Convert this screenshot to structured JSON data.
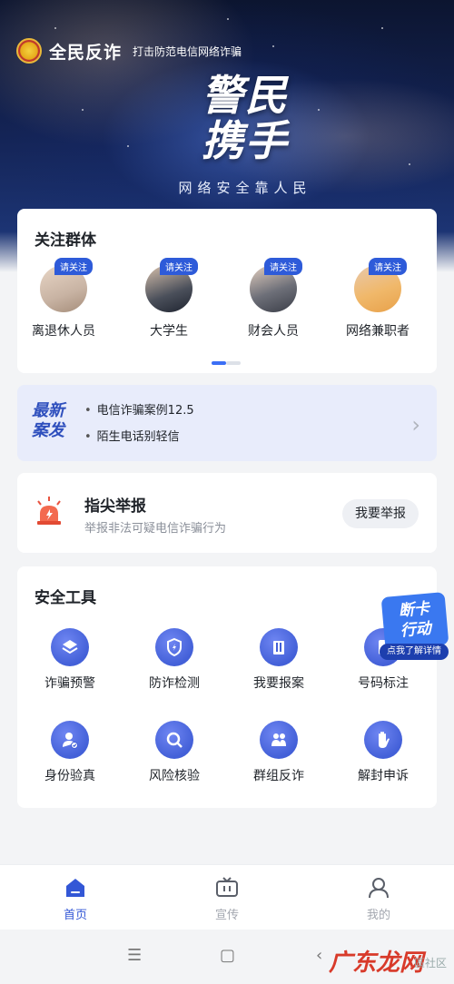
{
  "header": {
    "app_name": "全民反诈",
    "slogan": "打击防范电信网络诈骗"
  },
  "banner": {
    "title_line1": "警民",
    "title_line2": "携手",
    "subtitle": "网络安全靠人民"
  },
  "groups": {
    "title": "关注群体",
    "badge": "请关注",
    "items": [
      {
        "label": "离退休人员"
      },
      {
        "label": "大学生"
      },
      {
        "label": "财会人员"
      },
      {
        "label": "网络兼职者"
      }
    ]
  },
  "news": {
    "logo_line1": "最新",
    "logo_line2": "案发",
    "items": [
      "电信诈骗案例12.5",
      "陌生电话别轻信"
    ]
  },
  "report": {
    "title": "指尖举报",
    "subtitle": "举报非法可疑电信诈骗行为",
    "button": "我要举报"
  },
  "tools": {
    "title": "安全工具",
    "items": [
      {
        "label": "诈骗预警",
        "icon": "layers-icon"
      },
      {
        "label": "防诈检测",
        "icon": "shield-icon"
      },
      {
        "label": "我要报案",
        "icon": "report-book-icon"
      },
      {
        "label": "号码标注",
        "icon": "phone-tag-icon"
      },
      {
        "label": "身份验真",
        "icon": "id-verify-icon"
      },
      {
        "label": "风险核验",
        "icon": "search-icon"
      },
      {
        "label": "群组反诈",
        "icon": "group-icon"
      },
      {
        "label": "解封申诉",
        "icon": "hand-icon"
      }
    ]
  },
  "promo": {
    "line1": "断卡",
    "line2": "行动",
    "button": "点我了解详情"
  },
  "bottom_nav": [
    {
      "label": "首页",
      "icon": "home-icon",
      "active": true
    },
    {
      "label": "宣传",
      "icon": "tv-icon",
      "active": false
    },
    {
      "label": "我的",
      "icon": "user-icon",
      "active": false
    }
  ],
  "watermark": {
    "text": "广东龙网",
    "sub": "區社区"
  },
  "colors": {
    "accent": "#3357d6",
    "badge": "#2e5bd9",
    "tool_icon": "#4360d8"
  }
}
